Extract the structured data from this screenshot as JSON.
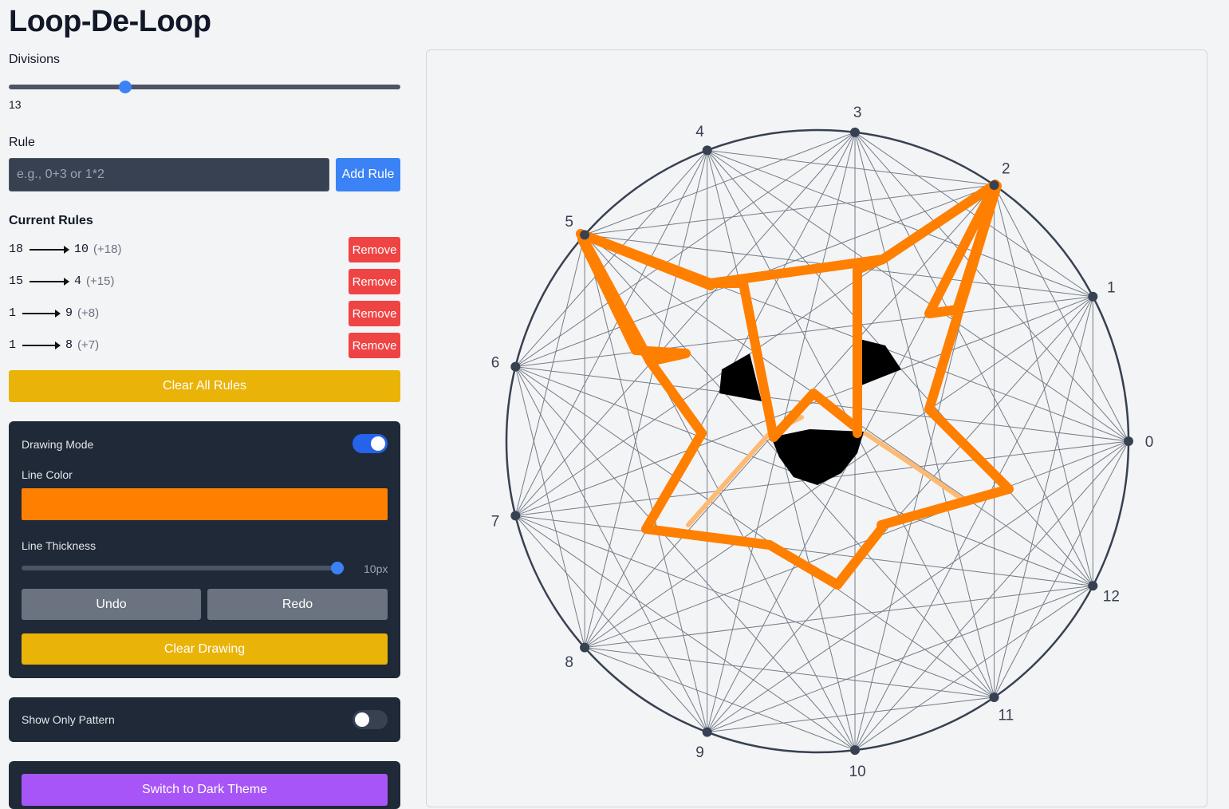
{
  "app": {
    "title": "Loop-De-Loop"
  },
  "divisions": {
    "label": "Divisions",
    "value": 13,
    "min": 2,
    "max": 40
  },
  "rule": {
    "label": "Rule",
    "placeholder": "e.g., 0+3 or 1*2",
    "value": "",
    "add_label": "Add Rule"
  },
  "current_rules": {
    "heading": "Current Rules",
    "remove_label": "Remove",
    "items": [
      {
        "from": "18",
        "to": "10",
        "offset": "(+18)"
      },
      {
        "from": "15",
        "to": "4",
        "offset": "(+15)"
      },
      {
        "from": "1",
        "to": "9",
        "offset": "(+8)"
      },
      {
        "from": "1",
        "to": "8",
        "offset": "(+7)"
      }
    ]
  },
  "clear_rules_label": "Clear All Rules",
  "drawing": {
    "mode_label": "Drawing Mode",
    "mode_on": true,
    "color_label": "Line Color",
    "color": "#ff7f00",
    "thickness_label": "Line Thickness",
    "thickness_value": "10px",
    "thickness_fraction": 1.0,
    "undo_label": "Undo",
    "redo_label": "Redo",
    "clear_label": "Clear Drawing"
  },
  "pattern": {
    "label": "Show Only Pattern",
    "on": false
  },
  "theme": {
    "switch_label": "Switch to Dark Theme"
  },
  "canvas": {
    "point_labels": [
      "0",
      "1",
      "2",
      "3",
      "4",
      "5",
      "6",
      "7",
      "8",
      "9",
      "10",
      "11",
      "12"
    ]
  },
  "colors": {
    "accent_blue": "#3b82f6",
    "danger_red": "#ef4444",
    "warning_yellow": "#eab308",
    "panel_dark": "#1f2937",
    "theme_purple": "#a855f7",
    "stroke_orange": "#ff7f00"
  }
}
